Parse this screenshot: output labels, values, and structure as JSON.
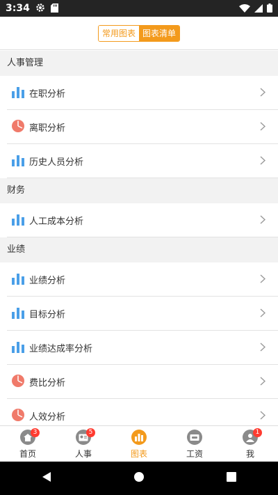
{
  "status_bar": {
    "time": "3:34"
  },
  "header": {
    "tabs": [
      {
        "label": "常用图表",
        "active": false
      },
      {
        "label": "图表清单",
        "active": true
      }
    ]
  },
  "colors": {
    "accent": "#f39a1c",
    "bar_icon": "#4a9fe8",
    "pie_icon": "#f07a6a",
    "badge": "#ff3b30"
  },
  "sections": [
    {
      "title": "人事管理",
      "items": [
        {
          "label": "在职分析",
          "icon": "bar-chart-icon"
        },
        {
          "label": "离职分析",
          "icon": "pie-chart-icon"
        },
        {
          "label": "历史人员分析",
          "icon": "bar-chart-icon"
        }
      ]
    },
    {
      "title": "财务",
      "items": [
        {
          "label": "人工成本分析",
          "icon": "bar-chart-icon"
        }
      ]
    },
    {
      "title": "业绩",
      "items": [
        {
          "label": "业绩分析",
          "icon": "bar-chart-icon"
        },
        {
          "label": "目标分析",
          "icon": "bar-chart-icon"
        },
        {
          "label": "业绩达成率分析",
          "icon": "bar-chart-icon"
        },
        {
          "label": "费比分析",
          "icon": "pie-chart-icon"
        },
        {
          "label": "人效分析",
          "icon": "pie-chart-icon"
        }
      ]
    }
  ],
  "tabbar": [
    {
      "label": "首页",
      "icon": "home-icon",
      "badge": "3"
    },
    {
      "label": "人事",
      "icon": "id-card-icon",
      "badge": "5"
    },
    {
      "label": "图表",
      "icon": "chart-icon",
      "badge": "",
      "active": true
    },
    {
      "label": "工资",
      "icon": "wallet-icon",
      "badge": ""
    },
    {
      "label": "我",
      "icon": "user-icon",
      "badge": "1"
    }
  ]
}
